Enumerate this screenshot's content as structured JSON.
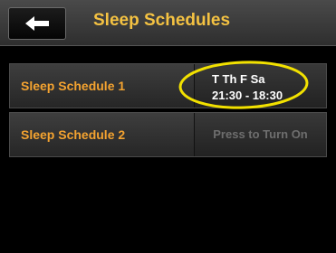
{
  "header": {
    "title": "Sleep Schedules",
    "back_icon": "left-arrow-icon"
  },
  "schedules": [
    {
      "label": "Sleep Schedule 1",
      "days": "T Th F Sa",
      "times": "21:30 - 18:30"
    },
    {
      "label": "Sleep Schedule 2",
      "status": "Press to Turn On"
    }
  ],
  "colors": {
    "title": "#f4c242",
    "row_label": "#f4a330",
    "annotation_ellipse": "#f2e100",
    "inactive_text": "#6e6e6e"
  }
}
